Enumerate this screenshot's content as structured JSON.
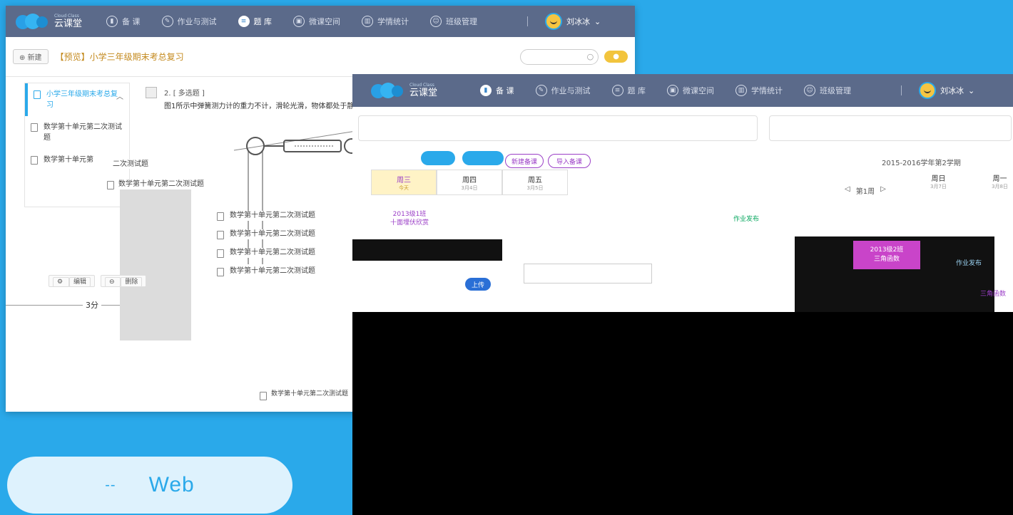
{
  "app": {
    "logo_name": "云课堂",
    "logo_sub": "Cloud Class"
  },
  "nav": {
    "items": [
      {
        "label": "备 课",
        "icon": "lesson-prep-icon",
        "active": true
      },
      {
        "label": "作业与测试",
        "icon": "pencil-icon",
        "active": false
      },
      {
        "label": "题 库",
        "icon": "question-bank-icon",
        "active": false
      },
      {
        "label": "微课空间",
        "icon": "micro-course-icon",
        "active": false
      },
      {
        "label": "学情统计",
        "icon": "chart-icon",
        "active": false
      },
      {
        "label": "班级管理",
        "icon": "class-icon",
        "active": false
      }
    ],
    "back_items": [
      {
        "label": "备 课",
        "icon": "lesson-prep-icon",
        "active": false
      },
      {
        "label": "作业与测试",
        "icon": "pencil-icon",
        "active": false
      },
      {
        "label": "题 库",
        "icon": "question-bank-icon",
        "active": true
      },
      {
        "label": "微课空间",
        "icon": "micro-course-icon",
        "active": false
      },
      {
        "label": "学情统计",
        "icon": "chart-icon",
        "active": false
      },
      {
        "label": "班级管理",
        "icon": "class-icon",
        "active": false
      }
    ],
    "user_name": "刘冰冰"
  },
  "back": {
    "new_button": "新建",
    "doc_title": "【预览】小学三年级期末考总复习",
    "sidebar": [
      {
        "label": "小学三年级期末考总复习",
        "active": true
      },
      {
        "label": "数学第十单元第二次测试题",
        "active": false
      },
      {
        "label": "数学第十单元第",
        "active": false
      }
    ],
    "question_number": "2. [ 多选题 ]",
    "question_text": "图1所示中弹簧测力计的重力不计，滑轮光滑，物体都处于静",
    "float_items": [
      "数学第十单元第二次测试题",
      "数学第十单元第二次测试题",
      "数学第十单元第二次测试题",
      "数学第十单元第二次测试题",
      "数学第十单元第二次测试题"
    ],
    "extra_label": "二次测试题",
    "edit_label": "编辑",
    "delete_label": "删除",
    "score": "3分",
    "bottom_doc": "数学第十单元第二次测试题"
  },
  "front": {
    "term": "2015-2016学年第2学期",
    "pill_left_1": "",
    "pill_left_2": "",
    "pill_purple_1": "新建备课",
    "pill_purple_2": "导入备课",
    "days": [
      {
        "name": "周三",
        "date": "今天",
        "today": true
      },
      {
        "name": "周四",
        "date": "3月4日",
        "today": false
      },
      {
        "name": "周五",
        "date": "3月5日",
        "today": false
      }
    ],
    "week_label": "第1周",
    "right_days": [
      {
        "name": "周日",
        "date": "3月7日"
      },
      {
        "name": "周一",
        "date": "3月8日"
      }
    ],
    "lesson_1": "2013级1班\n十面埋伏欣赏",
    "lesson_2": "2013级2班\n三角函数",
    "lesson_3": "三角函数",
    "green_1": "作业发布",
    "green_2": "作业发布",
    "upload": "上传"
  },
  "web_tag": {
    "dash": "--",
    "label": "Web"
  }
}
